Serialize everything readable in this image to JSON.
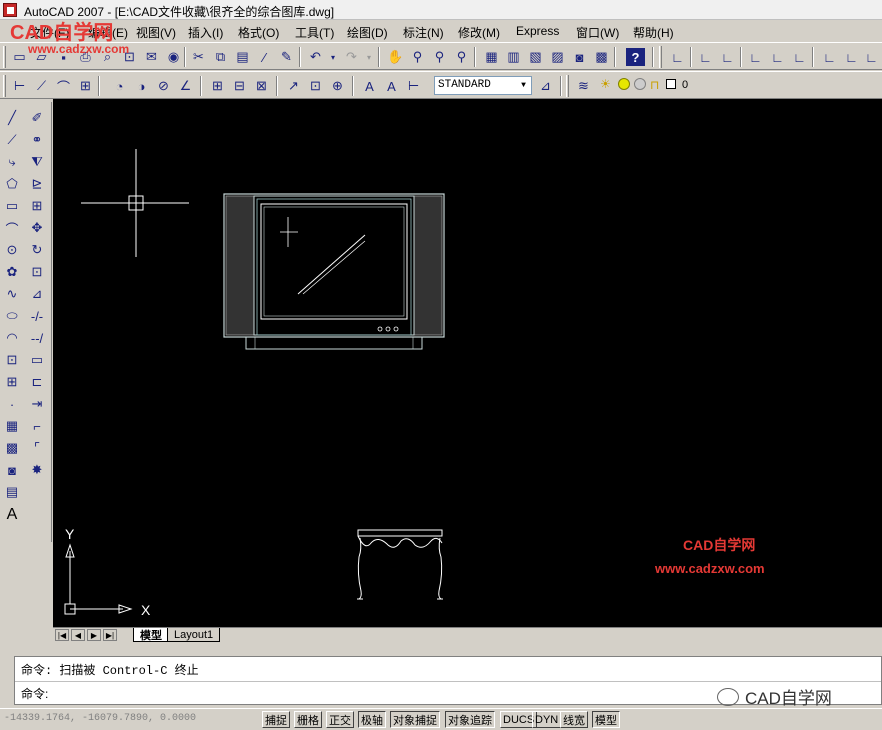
{
  "window": {
    "title": "AutoCAD 2007 - [E:\\CAD文件收藏\\很齐全的综合图库.dwg]"
  },
  "menus": [
    "文件(F)",
    "编辑(E)",
    "视图(V)",
    "插入(I)",
    "格式(O)",
    "工具(T)",
    "绘图(D)",
    "标注(N)",
    "修改(M)",
    "Express",
    "窗口(W)",
    "帮助(H)"
  ],
  "toolbar": {
    "text_style": "STANDARD",
    "layer_value": "0"
  },
  "overlay": {
    "brand_top": "CAD自学网",
    "url_top": "www.cadzxw.com",
    "brand_canvas": "CAD自学网",
    "url_canvas": "www.cadzxw.com",
    "wechat_brand": "CAD自学网"
  },
  "canvas": {
    "bg": "#000000",
    "ucs_x": "X",
    "ucs_y": "Y"
  },
  "tabs": [
    "模型",
    "Layout1"
  ],
  "command": {
    "line1": "命令: 扫描被 Control-C 终止",
    "line2": "命令:"
  },
  "status": {
    "coordinates": "-14339.1764, -16079.7890, 0.0000",
    "buttons": [
      {
        "label": "捕捉",
        "on": false
      },
      {
        "label": "栅格",
        "on": false
      },
      {
        "label": "正交",
        "on": false
      },
      {
        "label": "极轴",
        "on": true
      },
      {
        "label": "对象捕捉",
        "on": true
      },
      {
        "label": "对象追踪",
        "on": true
      },
      {
        "label": "DUCS",
        "on": false
      },
      {
        "label": "DYN",
        "on": false
      },
      {
        "label": "线宽",
        "on": false
      },
      {
        "label": "模型",
        "on": true
      }
    ]
  }
}
